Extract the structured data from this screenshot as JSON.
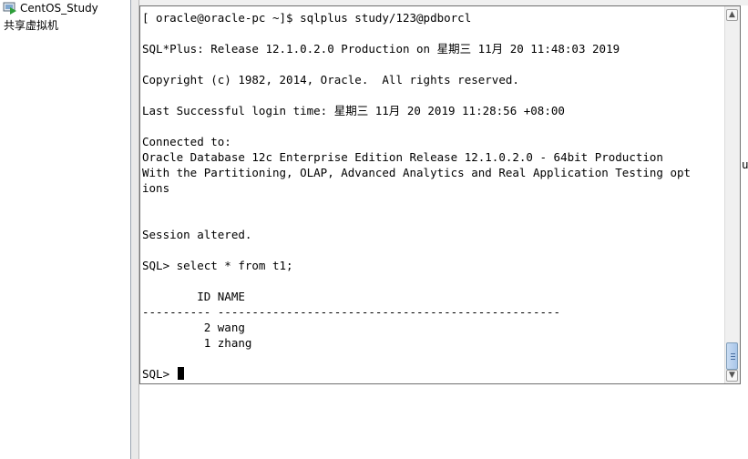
{
  "sidebar": {
    "items": [
      {
        "label": "CentOS_Study",
        "icon": "vm-icon"
      },
      {
        "label": "共享虚拟机"
      }
    ]
  },
  "edge_fragment": "u",
  "terminal": {
    "lines": [
      "[ oracle@oracle-pc ~]$ sqlplus study/123@pdborcl",
      "",
      "SQL*Plus: Release 12.1.0.2.0 Production on 星期三 11月 20 11:48:03 2019",
      "",
      "Copyright (c) 1982, 2014, Oracle.  All rights reserved.",
      "",
      "Last Successful login time: 星期三 11月 20 2019 11:28:56 +08:00",
      "",
      "Connected to:",
      "Oracle Database 12c Enterprise Edition Release 12.1.0.2.0 - 64bit Production",
      "With the Partitioning, OLAP, Advanced Analytics and Real Application Testing opt",
      "ions",
      "",
      "",
      "Session altered.",
      "",
      "SQL> select * from t1;",
      "",
      "        ID NAME",
      "---------- --------------------------------------------------",
      "         2 wang",
      "         1 zhang",
      "",
      "SQL> "
    ]
  }
}
